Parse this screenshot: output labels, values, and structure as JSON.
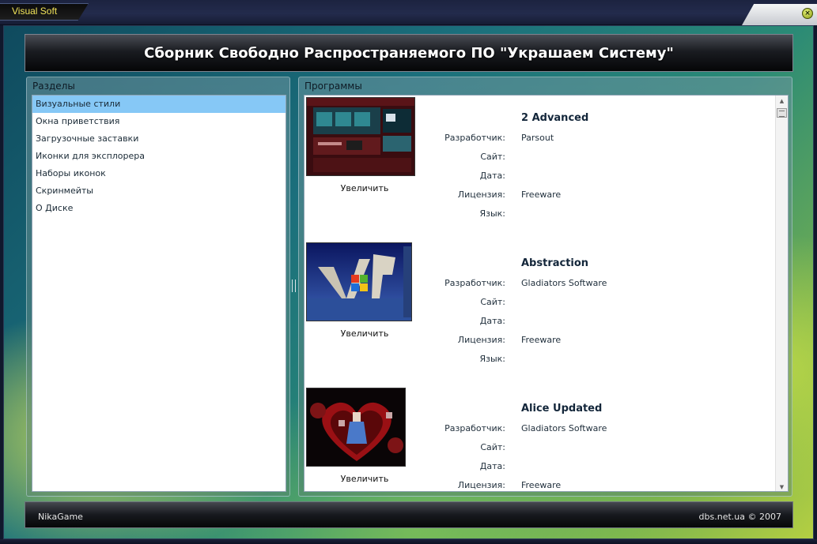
{
  "window": {
    "title": "Visual Soft",
    "close_glyph": "×"
  },
  "banner": {
    "title": "Сборник Свободно Распространяемого ПО \"Украшаем Систему\""
  },
  "sections": {
    "header": "Разделы",
    "items": [
      {
        "label": "Визуальные стили"
      },
      {
        "label": "Окна приветствия"
      },
      {
        "label": "Загрузочные заставки"
      },
      {
        "label": "Иконки для эксплорера"
      },
      {
        "label": "Наборы иконок"
      },
      {
        "label": "Скринмейты"
      },
      {
        "label": "О Диске"
      }
    ],
    "selected_index": 0
  },
  "programs": {
    "header": "Программы",
    "zoom_label": "Увеличить",
    "field_labels": {
      "developer": "Разработчик:",
      "site": "Сайт:",
      "date": "Дата:",
      "license": "Лицензия:",
      "language": "Язык:"
    },
    "entries": [
      {
        "name": "2 Advanced",
        "developer": "Parsout",
        "site": "",
        "date": "",
        "license": "Freeware",
        "language": ""
      },
      {
        "name": "Abstraction",
        "developer": "Gladiators Software",
        "site": "",
        "date": "",
        "license": "Freeware",
        "language": ""
      },
      {
        "name": "Alice Updated",
        "developer": "Gladiators Software",
        "site": "",
        "date": "",
        "license": "Freeware",
        "language": ""
      }
    ]
  },
  "footer": {
    "left": "NikaGame",
    "right": "dbs.net.ua © 2007"
  },
  "colors": {
    "title_text": "#f2e45a",
    "selected_item": "#86c8f6",
    "close_button": "#c8d84a"
  }
}
